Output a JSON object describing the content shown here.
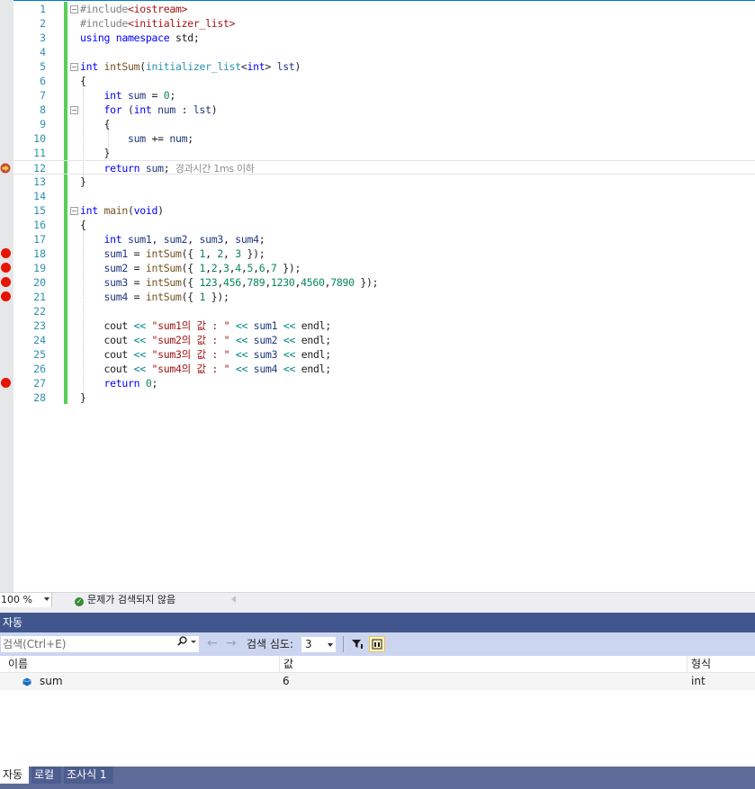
{
  "editor": {
    "current_line": 12,
    "breakpoint_lines": [
      18,
      19,
      20,
      21,
      27
    ],
    "perf_hint": "경과시간 1ms 이하",
    "lines": [
      {
        "n": "1",
        "tokens": [
          [
            "pp",
            "#include"
          ],
          [
            "str",
            "<iostream>"
          ]
        ]
      },
      {
        "n": "2",
        "tokens": [
          [
            "pp",
            "#include"
          ],
          [
            "str",
            "<initializer_list>"
          ]
        ]
      },
      {
        "n": "3",
        "tokens": [
          [
            "kw",
            "using"
          ],
          [
            "t",
            " "
          ],
          [
            "kw",
            "namespace"
          ],
          [
            "t",
            " std;"
          ]
        ]
      },
      {
        "n": "4",
        "tokens": []
      },
      {
        "n": "5",
        "tokens": [
          [
            "kw",
            "int"
          ],
          [
            "t",
            " "
          ],
          [
            "fn",
            "intSum"
          ],
          [
            "t",
            "("
          ],
          [
            "ty",
            "initializer_list"
          ],
          [
            "t",
            "<"
          ],
          [
            "kw",
            "int"
          ],
          [
            "t",
            "> "
          ],
          [
            "var",
            "lst"
          ],
          [
            "t",
            ")"
          ]
        ]
      },
      {
        "n": "6",
        "tokens": [
          [
            "t",
            "{"
          ]
        ]
      },
      {
        "n": "7",
        "tokens": [
          [
            "t",
            "    "
          ],
          [
            "kw",
            "int"
          ],
          [
            "t",
            " "
          ],
          [
            "var",
            "sum"
          ],
          [
            "t",
            " = "
          ],
          [
            "num",
            "0"
          ],
          [
            "t",
            ";"
          ]
        ]
      },
      {
        "n": "8",
        "tokens": [
          [
            "t",
            "    "
          ],
          [
            "kw",
            "for"
          ],
          [
            "t",
            " ("
          ],
          [
            "kw",
            "int"
          ],
          [
            "t",
            " "
          ],
          [
            "var",
            "num"
          ],
          [
            "t",
            " : "
          ],
          [
            "var",
            "lst"
          ],
          [
            "t",
            ")"
          ]
        ]
      },
      {
        "n": "9",
        "tokens": [
          [
            "t",
            "    {"
          ]
        ]
      },
      {
        "n": "10",
        "tokens": [
          [
            "t",
            "        "
          ],
          [
            "var",
            "sum"
          ],
          [
            "t",
            " += "
          ],
          [
            "var",
            "num"
          ],
          [
            "t",
            ";"
          ]
        ]
      },
      {
        "n": "11",
        "tokens": [
          [
            "t",
            "    }"
          ]
        ]
      },
      {
        "n": "12",
        "tokens": [
          [
            "t",
            "    "
          ],
          [
            "kw",
            "return"
          ],
          [
            "t",
            " "
          ],
          [
            "var",
            "sum"
          ],
          [
            "t",
            ";"
          ]
        ]
      },
      {
        "n": "13",
        "tokens": [
          [
            "t",
            "}"
          ]
        ]
      },
      {
        "n": "14",
        "tokens": []
      },
      {
        "n": "15",
        "tokens": [
          [
            "kw",
            "int"
          ],
          [
            "t",
            " "
          ],
          [
            "fn",
            "main"
          ],
          [
            "t",
            "("
          ],
          [
            "kw",
            "void"
          ],
          [
            "t",
            ")"
          ]
        ]
      },
      {
        "n": "16",
        "tokens": [
          [
            "t",
            "{"
          ]
        ]
      },
      {
        "n": "17",
        "tokens": [
          [
            "t",
            "    "
          ],
          [
            "kw",
            "int"
          ],
          [
            "t",
            " "
          ],
          [
            "var",
            "sum1"
          ],
          [
            "t",
            ", "
          ],
          [
            "var",
            "sum2"
          ],
          [
            "t",
            ", "
          ],
          [
            "var",
            "sum3"
          ],
          [
            "t",
            ", "
          ],
          [
            "var",
            "sum4"
          ],
          [
            "t",
            ";"
          ]
        ]
      },
      {
        "n": "18",
        "tokens": [
          [
            "t",
            "    "
          ],
          [
            "var",
            "sum1"
          ],
          [
            "t",
            " = "
          ],
          [
            "fn",
            "intSum"
          ],
          [
            "t",
            "({ "
          ],
          [
            "num",
            "1"
          ],
          [
            "t",
            ", "
          ],
          [
            "num",
            "2"
          ],
          [
            "t",
            ", "
          ],
          [
            "num",
            "3"
          ],
          [
            "t",
            " });"
          ]
        ]
      },
      {
        "n": "19",
        "tokens": [
          [
            "t",
            "    "
          ],
          [
            "var",
            "sum2"
          ],
          [
            "t",
            " = "
          ],
          [
            "fn",
            "intSum"
          ],
          [
            "t",
            "({ "
          ],
          [
            "num",
            "1"
          ],
          [
            "t",
            ","
          ],
          [
            "num",
            "2"
          ],
          [
            "t",
            ","
          ],
          [
            "num",
            "3"
          ],
          [
            "t",
            ","
          ],
          [
            "num",
            "4"
          ],
          [
            "t",
            ","
          ],
          [
            "num",
            "5"
          ],
          [
            "t",
            ","
          ],
          [
            "num",
            "6"
          ],
          [
            "t",
            ","
          ],
          [
            "num",
            "7"
          ],
          [
            "t",
            " });"
          ]
        ]
      },
      {
        "n": "20",
        "tokens": [
          [
            "t",
            "    "
          ],
          [
            "var",
            "sum3"
          ],
          [
            "t",
            " = "
          ],
          [
            "fn",
            "intSum"
          ],
          [
            "t",
            "({ "
          ],
          [
            "num",
            "123"
          ],
          [
            "t",
            ","
          ],
          [
            "num",
            "456"
          ],
          [
            "t",
            ","
          ],
          [
            "num",
            "789"
          ],
          [
            "t",
            ","
          ],
          [
            "num",
            "1230"
          ],
          [
            "t",
            ","
          ],
          [
            "num",
            "4560"
          ],
          [
            "t",
            ","
          ],
          [
            "num",
            "7890"
          ],
          [
            "t",
            " });"
          ]
        ]
      },
      {
        "n": "21",
        "tokens": [
          [
            "t",
            "    "
          ],
          [
            "var",
            "sum4"
          ],
          [
            "t",
            " = "
          ],
          [
            "fn",
            "intSum"
          ],
          [
            "t",
            "({ "
          ],
          [
            "num",
            "1"
          ],
          [
            "t",
            " });"
          ]
        ]
      },
      {
        "n": "22",
        "tokens": []
      },
      {
        "n": "23",
        "tokens": [
          [
            "t",
            "    cout "
          ],
          [
            "op",
            "<<"
          ],
          [
            "t",
            " "
          ],
          [
            "str",
            "\"sum1의 값 : \""
          ],
          [
            "t",
            " "
          ],
          [
            "op",
            "<<"
          ],
          [
            "t",
            " "
          ],
          [
            "var",
            "sum1"
          ],
          [
            "t",
            " "
          ],
          [
            "op",
            "<<"
          ],
          [
            "t",
            " endl;"
          ]
        ]
      },
      {
        "n": "24",
        "tokens": [
          [
            "t",
            "    cout "
          ],
          [
            "op",
            "<<"
          ],
          [
            "t",
            " "
          ],
          [
            "str",
            "\"sum2의 값 : \""
          ],
          [
            "t",
            " "
          ],
          [
            "op",
            "<<"
          ],
          [
            "t",
            " "
          ],
          [
            "var",
            "sum2"
          ],
          [
            "t",
            " "
          ],
          [
            "op",
            "<<"
          ],
          [
            "t",
            " endl;"
          ]
        ]
      },
      {
        "n": "25",
        "tokens": [
          [
            "t",
            "    cout "
          ],
          [
            "op",
            "<<"
          ],
          [
            "t",
            " "
          ],
          [
            "str",
            "\"sum3의 값 : \""
          ],
          [
            "t",
            " "
          ],
          [
            "op",
            "<<"
          ],
          [
            "t",
            " "
          ],
          [
            "var",
            "sum3"
          ],
          [
            "t",
            " "
          ],
          [
            "op",
            "<<"
          ],
          [
            "t",
            " endl;"
          ]
        ]
      },
      {
        "n": "26",
        "tokens": [
          [
            "t",
            "    cout "
          ],
          [
            "op",
            "<<"
          ],
          [
            "t",
            " "
          ],
          [
            "str",
            "\"sum4의 값 : \""
          ],
          [
            "t",
            " "
          ],
          [
            "op",
            "<<"
          ],
          [
            "t",
            " "
          ],
          [
            "var",
            "sum4"
          ],
          [
            "t",
            " "
          ],
          [
            "op",
            "<<"
          ],
          [
            "t",
            " endl;"
          ]
        ]
      },
      {
        "n": "27",
        "tokens": [
          [
            "t",
            "    "
          ],
          [
            "kw",
            "return"
          ],
          [
            "t",
            " "
          ],
          [
            "num",
            "0"
          ],
          [
            "t",
            ";"
          ]
        ]
      },
      {
        "n": "28",
        "tokens": [
          [
            "t",
            "}"
          ]
        ]
      }
    ]
  },
  "statusbar": {
    "zoom": "100 %",
    "issues_text": "문제가 검색되지 않음"
  },
  "autos": {
    "title": "자동",
    "search_placeholder": "검색(Ctrl+E)",
    "depth_label": "검색 심도:",
    "depth_value": "3",
    "columns": [
      "이름",
      "값",
      "형식"
    ],
    "rows": [
      {
        "name": "sum",
        "value": "6",
        "type": "int"
      }
    ]
  },
  "bottom_tabs": [
    "자동",
    "로컬",
    "조사식 1"
  ],
  "colors": {
    "breakpoint": "#e51400",
    "change_bar": "#55d057",
    "panel_title": "#40568d",
    "toolbar": "#ccd5f0"
  }
}
